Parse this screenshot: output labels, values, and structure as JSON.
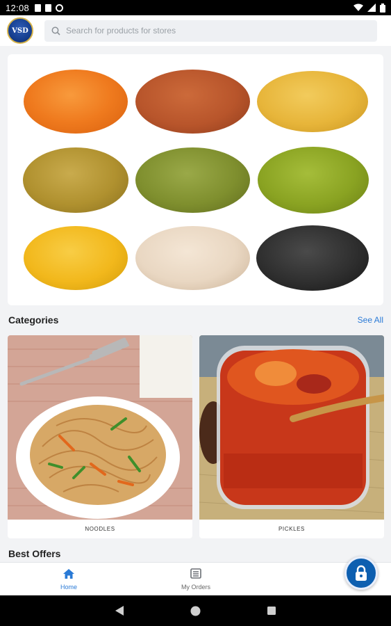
{
  "status_bar": {
    "time": "12:08"
  },
  "header": {
    "logo_text": "VSD",
    "search_placeholder": "Search for products for stores"
  },
  "banner": {
    "grains": [
      {
        "name": "red-lentils",
        "color": "#ef7a1e"
      },
      {
        "name": "chana",
        "color": "#b8552b"
      },
      {
        "name": "yellow-split-peas",
        "color": "#e7b53a"
      },
      {
        "name": "fenugreek",
        "color": "#b0912f"
      },
      {
        "name": "green-split-moong",
        "color": "#7f8f2e"
      },
      {
        "name": "green-moong",
        "color": "#8aa322"
      },
      {
        "name": "yellow-moong-dal",
        "color": "#f2b81c"
      },
      {
        "name": "white-chickpeas",
        "color": "#e9d7c2"
      },
      {
        "name": "black-urad",
        "color": "#2f2f2f"
      }
    ]
  },
  "categories": {
    "title": "Categories",
    "see_all": "See All",
    "items": [
      {
        "label": "NOODLES"
      },
      {
        "label": "PICKLES"
      }
    ]
  },
  "best_offers": {
    "title": "Best Offers"
  },
  "bottom_nav": {
    "items": [
      {
        "label": "Home",
        "icon": "home-icon",
        "active": true
      },
      {
        "label": "My Orders",
        "icon": "orders-icon",
        "active": false
      }
    ]
  },
  "colors": {
    "accent": "#2a7ad6",
    "fab": "#0d5fb0"
  }
}
